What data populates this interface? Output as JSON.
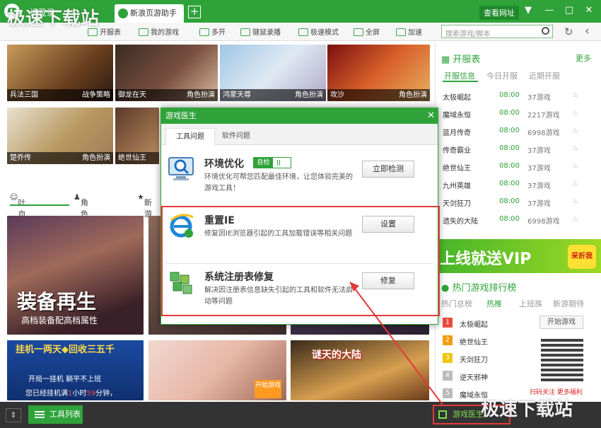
{
  "titlebar": {
    "login": "请登录",
    "tab": "新浪页游助手",
    "add_tab": "+",
    "view_site": "查看网址",
    "controls": [
      "▼",
      "—",
      "□",
      "✕"
    ]
  },
  "toolbar": {
    "items": [
      "开服表",
      "我的游戏",
      "多开",
      "键鼠录播",
      "极速模式",
      "全屏",
      "加速"
    ],
    "search_placeholder": "搜索游戏/脚本",
    "refresh": "↻",
    "back": "‹"
  },
  "tiles": [
    {
      "name": "兵法三国",
      "genre": "战争策略"
    },
    {
      "name": "御龙在天",
      "genre": "角色扮演"
    },
    {
      "name": "鸿蒙天尊",
      "genre": "角色扮演"
    },
    {
      "name": "攻沙",
      "genre": "角色扮演"
    },
    {
      "name": "楚乔传",
      "genre": "角色扮演"
    },
    {
      "name": "绝世仙王",
      "genre": ""
    },
    {
      "name": "",
      "genre": ""
    },
    {
      "name": "",
      "genre": ""
    },
    {
      "name": "",
      "genre": ""
    }
  ],
  "banners": {
    "b1_title": "装备再生",
    "b1_sub": "高档装备配高档属性",
    "b2_title": "挂机一两天◆回收三五千",
    "b2_sub": "开局一挂机 躺平不上班",
    "b2_line": "您已经挂机满",
    "b2_hours": "1",
    "b2_mid": "小时",
    "b2_mins": "59",
    "b2_tail": "分钟，",
    "b3_badge": "开始游戏",
    "b4_title": "谜天的大陆"
  },
  "categories": [
    "吐血推荐",
    "角色扮演",
    "新游"
  ],
  "right_panel": {
    "server_title": "开服表",
    "more": "更多",
    "tabs": [
      "开服信息",
      "今日开服",
      "近期开服"
    ],
    "rows": [
      {
        "game": "太极崛起",
        "time": "08:00",
        "server": "37游戏"
      },
      {
        "game": "魔域永恒",
        "time": "08:00",
        "server": "2217游戏"
      },
      {
        "game": "蓝月传奇",
        "time": "08:00",
        "server": "6998游戏"
      },
      {
        "game": "传奇霸业",
        "time": "08:00",
        "server": "37游戏"
      },
      {
        "game": "绝世仙王",
        "time": "08:00",
        "server": "37游戏"
      },
      {
        "game": "九州英雄",
        "time": "08:00",
        "server": "37游戏"
      },
      {
        "game": "天剑狂刀",
        "time": "08:00",
        "server": "37游戏"
      },
      {
        "game": "遗失的大陆",
        "time": "08:00",
        "server": "6998游戏"
      }
    ],
    "vip_banner": "上线就送VIP",
    "vip_badge": "采折我",
    "rank_title": "热门游戏排行榜",
    "rank_tabs": [
      "热门总榜",
      "热推",
      "上班族",
      "新游期待"
    ],
    "rank": [
      {
        "num": "1",
        "name": "太极崛起",
        "color": "#e84c3d"
      },
      {
        "num": "2",
        "name": "绝世仙王",
        "color": "#f39c12"
      },
      {
        "num": "3",
        "name": "天剑狂刀",
        "color": "#f1c40f"
      },
      {
        "num": "4",
        "name": "逆天邪神",
        "color": "#bbbbbb"
      },
      {
        "num": "5",
        "name": "魔域永恒",
        "color": "#bbbbbb"
      }
    ],
    "start_game": "开始游戏",
    "qr_text": "扫码关注 更多福利"
  },
  "bottombar": {
    "expand": "⇕",
    "tools": "工具列表",
    "doctor": "游戏医生"
  },
  "dialog": {
    "title": "游戏医生",
    "close": "✕",
    "tabs": [
      "工具问题",
      "软件问题"
    ],
    "sections": [
      {
        "title": "环境优化",
        "desc": "环境优化可帮您匹配最佳环境，让您体验完美的游戏工具！",
        "button": "立即检测",
        "toggle": "自检"
      },
      {
        "title": "重置IE",
        "desc": "修复因IE浏览器引起的工具加载错误等相关问题",
        "button": "设置"
      },
      {
        "title": "系统注册表修复",
        "desc": "解决因注册表信息缺失引起的工具和软件无法启动等问题",
        "button": "修复"
      }
    ]
  },
  "watermark": "极速下载站",
  "colors": {
    "brand_green": "#2fa33a",
    "accent_red": "#e43a3a"
  }
}
